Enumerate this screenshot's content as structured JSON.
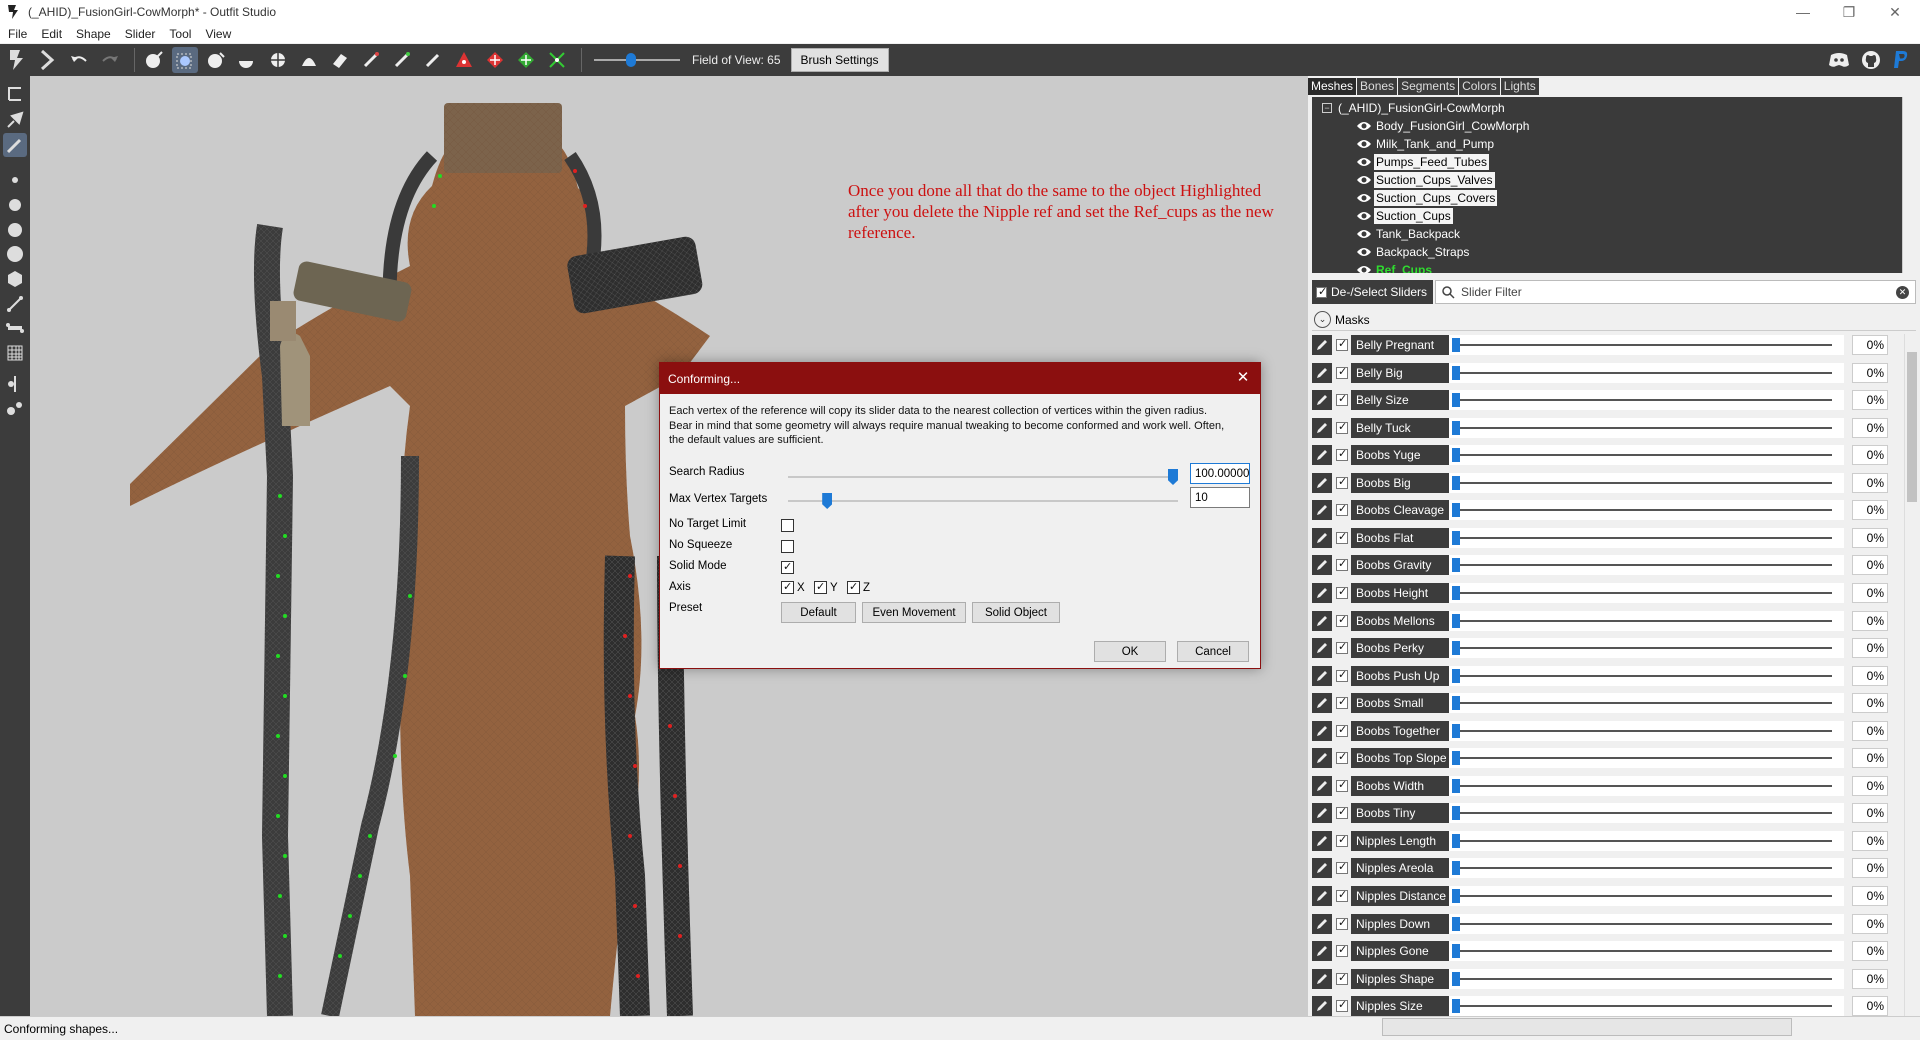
{
  "window": {
    "title": "(_AHID)_FusionGirl-CowMorph* - Outfit Studio",
    "minimize": "—",
    "maximize": "❐",
    "close": "✕"
  },
  "menu": [
    "File",
    "Edit",
    "Shape",
    "Slider",
    "Tool",
    "View"
  ],
  "toolbar": {
    "fov_label": "Field of View: 65",
    "fov_level": 0.42,
    "brush_settings": "Brush Settings"
  },
  "annotation": {
    "text": "Once you done all that do the same to the object Highlighted after you delete the Nipple ref and set the Ref_cups as the new reference."
  },
  "tabs": [
    "Meshes",
    "Bones",
    "Segments",
    "Colors",
    "Lights"
  ],
  "mesh_tree": {
    "root": "(_AHID)_FusionGirl-CowMorph",
    "meshes": [
      {
        "name": "Body_FusionGirl_CowMorph",
        "selected": false
      },
      {
        "name": "Milk_Tank_and_Pump",
        "selected": false
      },
      {
        "name": "Pumps_Feed_Tubes",
        "selected": true
      },
      {
        "name": "Suction_Cups_Valves",
        "selected": true
      },
      {
        "name": "Suction_Cups_Covers",
        "selected": true
      },
      {
        "name": "Suction_Cups",
        "selected": true
      },
      {
        "name": "Tank_Backpack",
        "selected": false
      },
      {
        "name": "Backpack_Straps",
        "selected": false
      },
      {
        "name": "Ref_Cups",
        "selected": false,
        "reference": true
      }
    ]
  },
  "slider_panel": {
    "deselect_label": "De-/Select Sliders",
    "filter_placeholder": "Slider Filter",
    "masks_label": "Masks",
    "sliders": [
      {
        "name": "Belly Pregnant",
        "value": "0%",
        "level": 0.0
      },
      {
        "name": "Belly Big",
        "value": "0%",
        "level": 0.0
      },
      {
        "name": "Belly Size",
        "value": "0%",
        "level": 0.0
      },
      {
        "name": "Belly Tuck",
        "value": "0%",
        "level": 0.0
      },
      {
        "name": "Boobs Yuge",
        "value": "0%",
        "level": 0.0
      },
      {
        "name": "Boobs Big",
        "value": "0%",
        "level": 0.0
      },
      {
        "name": "Boobs Cleavage",
        "value": "0%",
        "level": 0.0
      },
      {
        "name": "Boobs Flat",
        "value": "0%",
        "level": 0.0
      },
      {
        "name": "Boobs Gravity",
        "value": "0%",
        "level": 0.0
      },
      {
        "name": "Boobs Height",
        "value": "0%",
        "level": 0.0
      },
      {
        "name": "Boobs Mellons",
        "value": "0%",
        "level": 0.0
      },
      {
        "name": "Boobs Perky",
        "value": "0%",
        "level": 0.0
      },
      {
        "name": "Boobs Push Up",
        "value": "0%",
        "level": 0.0
      },
      {
        "name": "Boobs Small",
        "value": "0%",
        "level": 0.0
      },
      {
        "name": "Boobs Together",
        "value": "0%",
        "level": 0.0
      },
      {
        "name": "Boobs Top Slope",
        "value": "0%",
        "level": 0.0
      },
      {
        "name": "Boobs Width",
        "value": "0%",
        "level": 0.0
      },
      {
        "name": "Boobs Tiny",
        "value": "0%",
        "level": 0.0
      },
      {
        "name": "Nipples Length",
        "value": "0%",
        "level": 0.0
      },
      {
        "name": "Nipples Areola",
        "value": "0%",
        "level": 0.0
      },
      {
        "name": "Nipples Distance",
        "value": "0%",
        "level": 0.0
      },
      {
        "name": "Nipples Down",
        "value": "0%",
        "level": 0.0
      },
      {
        "name": "Nipples Gone",
        "value": "0%",
        "level": 0.0
      },
      {
        "name": "Nipples Shape",
        "value": "0%",
        "level": 0.0
      },
      {
        "name": "Nipples Size",
        "value": "0%",
        "level": 0.0
      }
    ]
  },
  "dialog": {
    "title": "Conforming...",
    "close": "✕",
    "description": "Each vertex of the reference will copy its slider data to the nearest collection of vertices within the given radius. Bear in mind that some geometry will always require manual tweaking to become conformed and work well. Often, the default values are sufficient.",
    "search_radius_label": "Search Radius",
    "search_radius_value": "100.00000",
    "search_radius_level": 1.0,
    "max_vertex_targets_label": "Max Vertex Targets",
    "max_vertex_targets_value": "10",
    "max_vertex_targets_level": 0.09,
    "no_target_limit_label": "No Target Limit",
    "no_target_limit": false,
    "no_squeeze_label": "No Squeeze",
    "no_squeeze": false,
    "solid_mode_label": "Solid Mode",
    "solid_mode": true,
    "axis_label": "Axis",
    "axis": [
      {
        "label": "X",
        "checked": true
      },
      {
        "label": "Y",
        "checked": true
      },
      {
        "label": "Z",
        "checked": true
      }
    ],
    "preset_label": "Preset",
    "presets": [
      "Default",
      "Even Movement",
      "Solid Object"
    ],
    "ok": "OK",
    "cancel": "Cancel"
  },
  "status": {
    "text": "Conforming shapes..."
  },
  "colors": {
    "dialog_title_bg": "#8b0f0f",
    "toolbar_bg": "#3c3c3c",
    "accent": "#1e7ad6",
    "annotation": "#cc1111",
    "reference_mesh": "#2fdc2f",
    "viewport_bg": "#cbcbcb"
  },
  "icons": {
    "toolbar": [
      "select-icon",
      "transform-icon",
      "undo-icon",
      "redo-icon",
      "standard-brush-icon",
      "mask-brush-icon",
      "inflate-brush-icon",
      "deflate-brush-icon",
      "move-brush-icon",
      "smooth-brush-icon",
      "undiff-brush-icon",
      "weight-brush-icon",
      "color-brush-icon",
      "alpha-brush-icon",
      "collision-brush-icon",
      "anchor-icon",
      "center-icon",
      "vertex-select-icon"
    ],
    "right": [
      "discord-icon",
      "github-icon",
      "paypal-icon"
    ],
    "left": [
      "transform-icon",
      "pivot-icon",
      "brush-icon",
      "small-brush-icon",
      "medium-brush-icon",
      "large-brush-icon",
      "sphere-icon",
      "cube-icon",
      "vertex-icon",
      "bone-icon",
      "grid-icon",
      "symmetry-icon",
      "weights-icon"
    ]
  }
}
